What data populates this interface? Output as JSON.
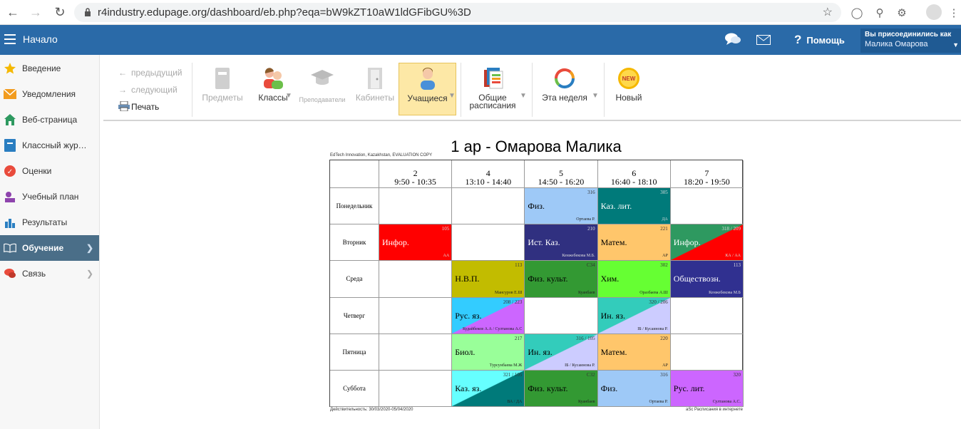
{
  "browser": {
    "url": "r4industry.edupage.org/dashboard/eb.php?eqa=bW9kZT10aW1ldGFibGU%3D"
  },
  "topbar": {
    "title": "Начало",
    "help": "Помощь",
    "user_label": "Вы присоединились как",
    "user_name": "Малика Омарова",
    "color": "#2a6aa8"
  },
  "sidebar": {
    "items": [
      {
        "label": "Введение",
        "icon": "star-icon"
      },
      {
        "label": "Уведомления",
        "icon": "envelope-icon"
      },
      {
        "label": "Веб-страница",
        "icon": "house-icon"
      },
      {
        "label": "Классный жур…",
        "icon": "journal-icon"
      },
      {
        "label": "Оценки",
        "icon": "grade-icon"
      },
      {
        "label": "Учебный план",
        "icon": "plan-icon"
      },
      {
        "label": "Результаты",
        "icon": "bar-chart-icon"
      },
      {
        "label": "Обучение",
        "icon": "book-icon",
        "active": true
      },
      {
        "label": "Связь",
        "icon": "chat-icon"
      }
    ]
  },
  "toolbar": {
    "prev": "предыдущий",
    "next": "следующий",
    "print": "Печать",
    "subjects": "Предметы",
    "classes": "Классы",
    "teachers": "Преподаватели",
    "rooms": "Кабинеты",
    "students": "Учащиеся",
    "common1": "Общие",
    "common2": "расписания",
    "this_week": "Эта неделя",
    "new_label": "Новый",
    "new_badge": "NEW"
  },
  "timetable": {
    "title": "1 ар - Омарова Малика",
    "copyright": "EdTech Innovation, Kazakhstan, EVALUATION COPY",
    "footer_left": "Действительность: 30/03/2020-05/04/2020",
    "footer_right": "aSc Расписания в интернете",
    "periods": [
      {
        "num": "2",
        "time": "9:50 - 10:35"
      },
      {
        "num": "4",
        "time": "13:10 - 14:40"
      },
      {
        "num": "5",
        "time": "14:50 - 16:20"
      },
      {
        "num": "6",
        "time": "16:40 - 18:10"
      },
      {
        "num": "7",
        "time": "18:20 - 19:50"
      }
    ],
    "days": [
      "Понедельник",
      "Вторник",
      "Среда",
      "Четверг",
      "Пятница",
      "Суббота"
    ],
    "cells": [
      {
        "d": 0,
        "p": 2,
        "subject": "Физ.",
        "room": "316",
        "teacher": "Ортаева Р.",
        "color": "#9ec9f7"
      },
      {
        "d": 0,
        "p": 3,
        "subject": "Каз. лит.",
        "room": "305",
        "teacher": "ДА",
        "color": "#007a7a",
        "light": true
      },
      {
        "d": 1,
        "p": 0,
        "subject": "Инфор.",
        "room": "105",
        "teacher": "АА",
        "color": "#ff0000",
        "light": true
      },
      {
        "d": 1,
        "p": 2,
        "subject": "Ист. Каз.",
        "room": "210",
        "teacher": "Кенжебекова М.Б.",
        "color": "#303080",
        "light": true
      },
      {
        "d": 1,
        "p": 3,
        "subject": "Матем.",
        "room": "221",
        "teacher": "АР",
        "color": "#ffc66b"
      },
      {
        "d": 1,
        "p": 4,
        "subject": "Инфор.",
        "room": "318 / 209",
        "teacher": "КА / АА",
        "color": "#2e9960",
        "color2": "#ff0000",
        "light": true
      },
      {
        "d": 2,
        "p": 1,
        "subject": "Н.В.П.",
        "room": "113",
        "teacher": "Мансуров Е.Ш",
        "color": "#c2bc00"
      },
      {
        "d": 2,
        "p": 2,
        "subject": "Физ. культ.",
        "room": "С34",
        "teacher": "Куанбаев",
        "color": "#339933"
      },
      {
        "d": 2,
        "p": 3,
        "subject": "Хим.",
        "room": "302",
        "teacher": "Оразбаева А.Ш",
        "color": "#66ff33"
      },
      {
        "d": 2,
        "p": 4,
        "subject": "Обществозн.",
        "room": "113",
        "teacher": "Кенжебекова М.Б",
        "color": "#303090",
        "light": true
      },
      {
        "d": 3,
        "p": 1,
        "subject": "Рус. яз.",
        "room": "208 / 223",
        "teacher": "Кудайбеков А.А / Султанова А.С",
        "color": "#33ccff",
        "color2": "#cc66ff"
      },
      {
        "d": 3,
        "p": 3,
        "subject": "Ин. яз.",
        "room": "320 / 206",
        "teacher": "ІБ / Кусаинова Р.",
        "color": "#33ccbb",
        "color2": "#ccccff"
      },
      {
        "d": 4,
        "p": 1,
        "subject": "Биол.",
        "room": "217",
        "teacher": "Турсунбаева М.Ж",
        "color": "#99ff99"
      },
      {
        "d": 4,
        "p": 2,
        "subject": "Ин. яз.",
        "room": "316 / 105",
        "teacher": "ІБ / Кусаинова Р.",
        "color": "#33ccbb",
        "color2": "#ccccff"
      },
      {
        "d": 4,
        "p": 3,
        "subject": "Матем.",
        "room": "220",
        "teacher": "АР",
        "color": "#ffc66b"
      },
      {
        "d": 5,
        "p": 1,
        "subject": "Каз. яз.",
        "room": "321 / 105",
        "teacher": "ВА / ДА",
        "color": "#66ffff",
        "color2": "#007a7a"
      },
      {
        "d": 5,
        "p": 2,
        "subject": "Физ. культ.",
        "room": "С32",
        "teacher": "Куанбаев",
        "color": "#339933"
      },
      {
        "d": 5,
        "p": 3,
        "subject": "Физ.",
        "room": "316",
        "teacher": "Ортаева Р.",
        "color": "#9ec9f7"
      },
      {
        "d": 5,
        "p": 4,
        "subject": "Рус. лит.",
        "room": "320",
        "teacher": "Султанова А.С.",
        "color": "#cc66ff"
      }
    ]
  }
}
